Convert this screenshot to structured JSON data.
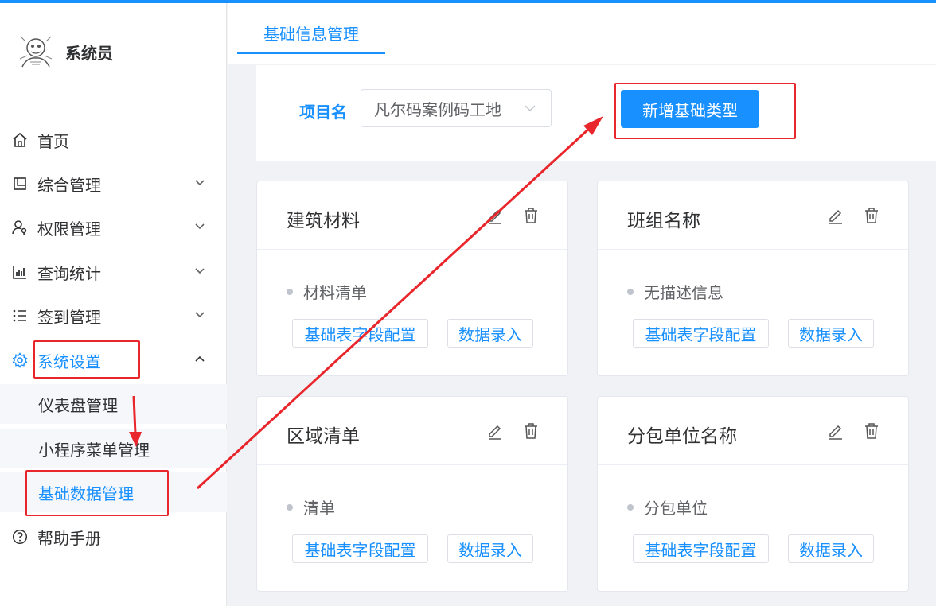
{
  "sidebar": {
    "username": "系统员",
    "menu": [
      {
        "label": "首页",
        "icon": "home-icon"
      },
      {
        "label": "综合管理",
        "icon": "document-icon"
      },
      {
        "label": "权限管理",
        "icon": "user-key-icon"
      },
      {
        "label": "查询统计",
        "icon": "bar-chart-icon"
      },
      {
        "label": "签到管理",
        "icon": "list-icon"
      },
      {
        "label": "系统设置",
        "icon": "gear-icon"
      },
      {
        "label": "帮助手册",
        "icon": "help-icon"
      }
    ],
    "submenu": [
      {
        "label": "仪表盘管理"
      },
      {
        "label": "小程序菜单管理"
      },
      {
        "label": "基础数据管理"
      }
    ]
  },
  "tabs": {
    "active": "基础信息管理"
  },
  "filter": {
    "label": "项目名",
    "select_value": "凡尔码案例码工地",
    "add_button": "新增基础类型"
  },
  "cards": [
    {
      "title": "建筑材料",
      "desc": "材料清单",
      "btn_config": "基础表字段配置",
      "btn_entry": "数据录入"
    },
    {
      "title": "班组名称",
      "desc": "无描述信息",
      "btn_config": "基础表字段配置",
      "btn_entry": "数据录入"
    },
    {
      "title": "区域清单",
      "desc": "清单",
      "btn_config": "基础表字段配置",
      "btn_entry": "数据录入"
    },
    {
      "title": "分包单位名称",
      "desc": "分包单位",
      "btn_config": "基础表字段配置",
      "btn_entry": "数据录入"
    }
  ],
  "colors": {
    "primary": "#1890ff",
    "annotation": "#e8262b"
  }
}
